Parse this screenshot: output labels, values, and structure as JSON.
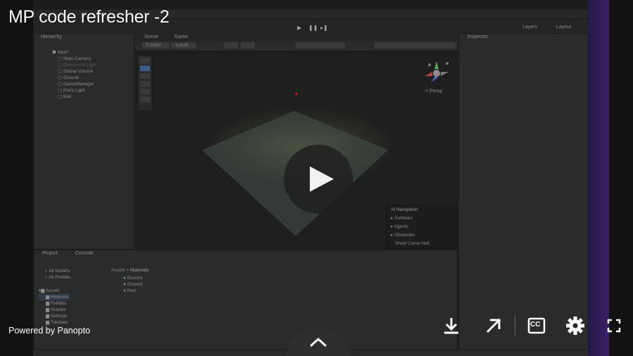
{
  "video": {
    "title": "MP code refresher -2",
    "powered_by": "Powered by Panopto"
  },
  "controls": {
    "play_icon": "play-icon",
    "download_icon": "download-icon",
    "popout_icon": "arrow-up-right-icon",
    "captions_label": "CC",
    "settings_icon": "gear-icon",
    "fullscreen_icon": "fullscreen-icon",
    "expand_icon": "chevron-up-icon"
  },
  "editor": {
    "hierarchy_tab": "Hierarchy",
    "scene_tab": "Scene",
    "game_tab": "Game",
    "inspector_tab": "Inspector",
    "project_tab": "Project",
    "console_tab": "Console",
    "layers_label": "Layers",
    "layout_label": "Layout",
    "center_label": "Center",
    "local_label": "Local",
    "persp_label": "< Persp",
    "hierarchy": {
      "root": "Main*",
      "items": [
        "Main Camera",
        "Directional Light",
        "Global Volume",
        "Ground",
        "GameManager",
        "Point Light",
        "Ball"
      ]
    },
    "project": {
      "search_items": [
        "All Models",
        "All Prefabs"
      ],
      "assets_root": "Assets",
      "folders": [
        "Materials",
        "Prefabs",
        "Scenes",
        "Settings",
        "Tutorials"
      ],
      "breadcrumb": [
        "Assets",
        "Materials"
      ],
      "materials": [
        "Bounce",
        "Ground",
        "Red"
      ]
    },
    "ai_navigation": {
      "title": "AI Navigation",
      "items": [
        "Surfaces",
        "Agents",
        "Obstacles",
        "Show Carve Hull"
      ]
    }
  }
}
